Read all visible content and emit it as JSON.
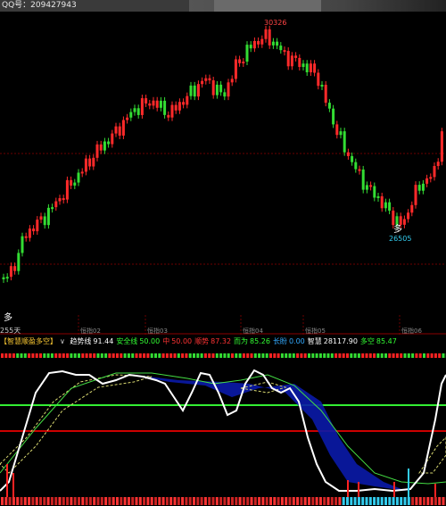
{
  "watermark": {
    "text": "QQ号：209427943"
  },
  "main_chart": {
    "high_label": "30326",
    "low_label": "26505",
    "left_label": "255天",
    "marker_bottom_left": "多",
    "marker_low": "多",
    "date_labels": [
      "恒指02",
      "恒指03",
      "恒指04",
      "恒指05",
      "恒指06"
    ]
  },
  "indicator": {
    "name": "【智慧顺盈多空】",
    "dropdown": "∨",
    "items": [
      {
        "label": "趋势线",
        "value": "91.44",
        "label_color": "#ffffff",
        "value_color": "#ffffff"
      },
      {
        "label": "安全线",
        "value": "50.00",
        "label_color": "#33ff33",
        "value_color": "#33ff33"
      },
      {
        "label": "中",
        "value": "50.00",
        "label_color": "#ff3333",
        "value_color": "#ff3333"
      },
      {
        "label": "顺势",
        "value": "87.32",
        "label_color": "#ff3333",
        "value_color": "#ff3333"
      },
      {
        "label": "而为",
        "value": "85.26",
        "label_color": "#33ff33",
        "value_color": "#33ff33"
      },
      {
        "label": "长盼",
        "value": "0.00",
        "label_color": "#33aaff",
        "value_color": "#33aaff"
      },
      {
        "label": "智慧",
        "value": "28117.90",
        "label_color": "#ffffff",
        "value_color": "#ffffff"
      },
      {
        "label": "多空",
        "value": "85.47",
        "label_color": "#33ff33",
        "value_color": "#33ff33"
      }
    ]
  },
  "colors": {
    "up": "#ff2a2a",
    "down": "#33dd33",
    "grid": "#6b0000",
    "trend": "#ffffff",
    "blue_band": "#0a1aa8",
    "yellow_band": "#d8d870"
  }
}
